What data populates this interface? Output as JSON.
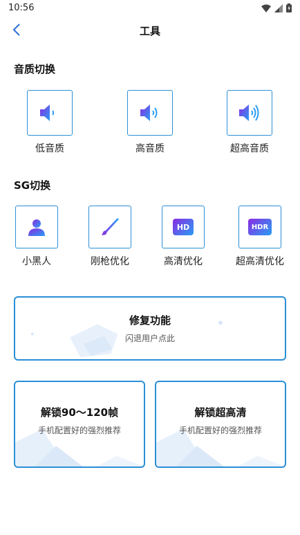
{
  "status": {
    "time": "10:56"
  },
  "header": {
    "title": "工具"
  },
  "audio": {
    "title": "音质切换",
    "items": [
      {
        "label": "低音质",
        "icon": "speaker-low-icon"
      },
      {
        "label": "高音质",
        "icon": "speaker-medium-icon"
      },
      {
        "label": "超高音质",
        "icon": "speaker-high-icon"
      }
    ]
  },
  "sg": {
    "title": "SG切换",
    "items": [
      {
        "label": "小黑人",
        "icon": "person-icon"
      },
      {
        "label": "刚枪优化",
        "icon": "rifle-icon"
      },
      {
        "label": "高清优化",
        "icon": "hd-icon",
        "badge": "HD"
      },
      {
        "label": "超高清优化",
        "icon": "hdr-icon",
        "badge": "HDR"
      }
    ]
  },
  "cards": {
    "repair": {
      "title": "修复功能",
      "subtitle": "闪退用户点此"
    },
    "fps": {
      "title": "解锁90～120帧",
      "subtitle": "手机配置好的强烈推荐"
    },
    "uhd": {
      "title": "解锁超高清",
      "subtitle": "手机配置好的强烈推荐"
    }
  },
  "colors": {
    "accent": "#2a8fd6",
    "icon_gradient_start": "#8a2be2",
    "icon_gradient_end": "#2a9df4"
  }
}
